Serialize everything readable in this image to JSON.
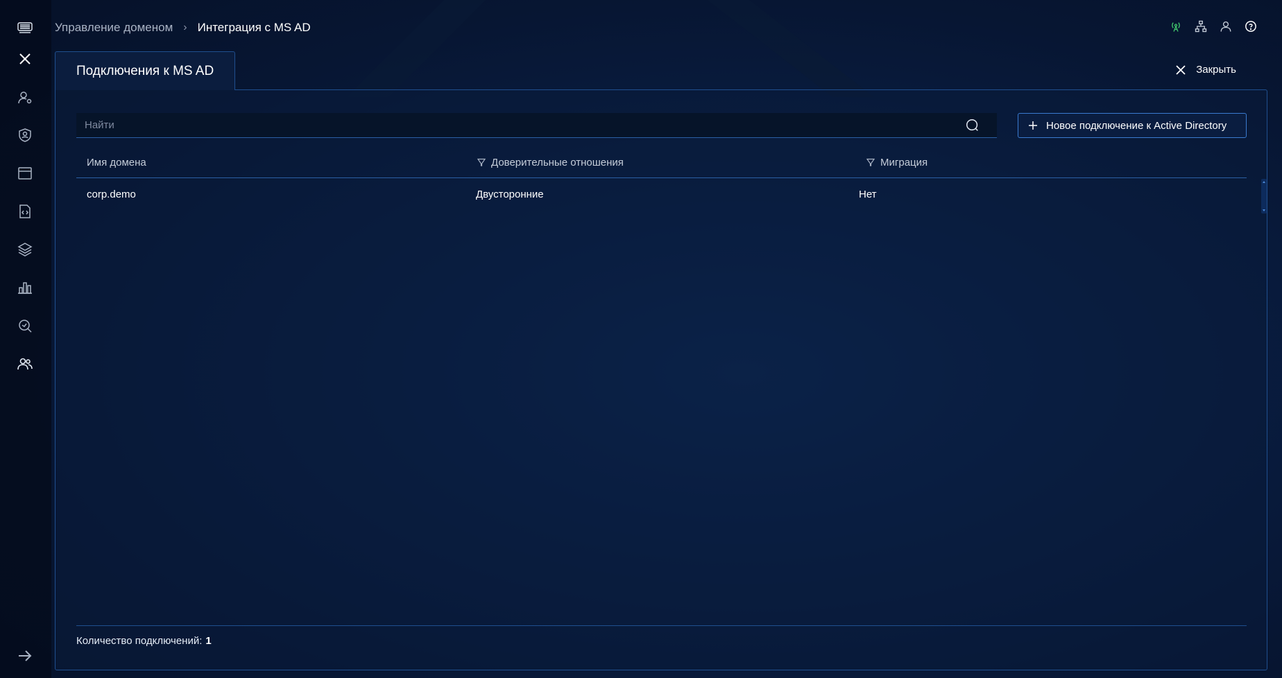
{
  "header": {
    "breadcrumb_parent": "Управление доменом",
    "breadcrumb_separator": "›",
    "breadcrumb_current": "Интеграция с MS AD"
  },
  "tab": {
    "label": "Подключения к MS AD"
  },
  "close_label": "Закрыть",
  "search": {
    "placeholder": "Найти",
    "value": ""
  },
  "new_connection_label": "Новое подключение к Active Directory",
  "table": {
    "columns": [
      "Имя домена",
      "Доверительные отношения",
      "Миграция"
    ],
    "rows": [
      [
        "corp.demo",
        "Двусторонние",
        "Нет"
      ]
    ]
  },
  "footer": {
    "count_label": "Количество подключений:",
    "count_value": "1"
  },
  "colors": {
    "accent": "#3a7bd0",
    "border": "#1f4f8f",
    "status_green": "#3fc26b"
  }
}
